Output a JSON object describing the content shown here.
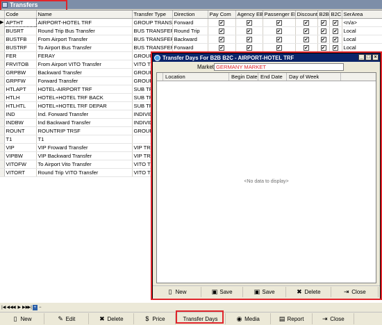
{
  "window": {
    "title": "Transfers"
  },
  "grid": {
    "headers": [
      "Code",
      "Name",
      "Transfer Type",
      "Direction",
      "Pay Com",
      "Agency EB",
      "Passenger EB",
      "Discount",
      "B2B",
      "B2C",
      "SerArea"
    ],
    "rows": [
      {
        "code": "APTHT",
        "name": "AIRPORT-HOTEL TRF",
        "type": "GROUP TRANSF",
        "direction": "Forward",
        "checks": [
          true,
          true,
          true,
          true,
          true,
          true
        ],
        "area": "<n/a>"
      },
      {
        "code": "BUSRT",
        "name": "Round Trip Bus Transfer",
        "type": "BUS TRANSFER",
        "direction": "Round Trip",
        "checks": [
          true,
          true,
          true,
          true,
          true,
          true
        ],
        "area": "Local"
      },
      {
        "code": "BUSTFB",
        "name": "From Airport Transfer",
        "type": "BUS TRANSFER",
        "direction": "Backward",
        "checks": [
          true,
          true,
          true,
          true,
          true,
          true
        ],
        "area": "Local"
      },
      {
        "code": "BUSTRF",
        "name": "To Airport Bus Transfer",
        "type": "BUS TRANSFER",
        "direction": "Forward",
        "checks": [
          true,
          true,
          true,
          true,
          true,
          true
        ],
        "area": "Local"
      },
      {
        "code": "FER",
        "name": "FERAY",
        "type": "GROUP",
        "direction": "",
        "checks": [],
        "area": ""
      },
      {
        "code": "FRVITOB",
        "name": "From Airport VITO Transfer",
        "type": "VITO TR",
        "direction": "",
        "checks": [],
        "area": ""
      },
      {
        "code": "GRPBW",
        "name": "Backward Transfer",
        "type": "GROUP",
        "direction": "",
        "checks": [],
        "area": ""
      },
      {
        "code": "GRPFW",
        "name": "Forward Transfer",
        "type": "GROUP",
        "direction": "",
        "checks": [],
        "area": ""
      },
      {
        "code": "HTLAPT",
        "name": "HOTEL-AIRPORT TRF",
        "type": "SUB TR",
        "direction": "",
        "checks": [],
        "area": ""
      },
      {
        "code": "HTLH",
        "name": "HOTEL+HOTEL TRF BACK",
        "type": "SUB TR",
        "direction": "",
        "checks": [],
        "area": ""
      },
      {
        "code": "HTLHTL",
        "name": "HOTEL+HOTEL TRF DEPAR",
        "type": "SUB TR",
        "direction": "",
        "checks": [],
        "area": ""
      },
      {
        "code": "IND",
        "name": "Ind. Forward Transfer",
        "type": "INDIVID",
        "direction": "",
        "checks": [],
        "area": ""
      },
      {
        "code": "INDBW",
        "name": "Ind Backward Transfer",
        "type": "INDIVID",
        "direction": "",
        "checks": [],
        "area": ""
      },
      {
        "code": "ROUNT",
        "name": "ROUNTRIP TRSF",
        "type": "GROUP",
        "direction": "",
        "checks": [],
        "area": ""
      },
      {
        "code": "T1",
        "name": "T1",
        "type": "",
        "direction": "",
        "checks": [],
        "area": ""
      },
      {
        "code": "VIP",
        "name": "VIP Froward Transfer",
        "type": "VIP TRA",
        "direction": "",
        "checks": [],
        "area": ""
      },
      {
        "code": "VIPBW",
        "name": "VIP Backward Transfer",
        "type": "VIP TRA",
        "direction": "",
        "checks": [],
        "area": ""
      },
      {
        "code": "VITOFW",
        "name": "To Airport Vito Transfer",
        "type": "VITO TR",
        "direction": "",
        "checks": [],
        "area": ""
      },
      {
        "code": "VITORT",
        "name": "Round Trip VITO Transfer",
        "type": "VITO TR",
        "direction": "",
        "checks": [],
        "area": ""
      }
    ]
  },
  "toolbar": [
    {
      "name": "new-button",
      "icon": "new-doc-icon",
      "glyph": "▯",
      "label": "New"
    },
    {
      "name": "edit-button",
      "icon": "edit-icon",
      "glyph": "✎",
      "label": "Edit"
    },
    {
      "name": "delete-button",
      "icon": "delete-icon",
      "glyph": "✖",
      "label": "Delete"
    },
    {
      "name": "price-button",
      "icon": "price-icon",
      "glyph": "$",
      "label": "Price"
    },
    {
      "name": "transfer-days-button",
      "icon": "",
      "glyph": "",
      "label": "Transfer Days"
    },
    {
      "name": "media-button",
      "icon": "media-icon",
      "glyph": "◉",
      "label": "Media"
    },
    {
      "name": "report-button",
      "icon": "printer-icon",
      "glyph": "▤",
      "label": "Report"
    },
    {
      "name": "close-button",
      "icon": "close-icon",
      "glyph": "⇥",
      "label": "Close"
    }
  ],
  "dialog": {
    "title": "Transfer Days For B2B B2C - AIRPORT-HOTEL TRF",
    "market_label": "Market",
    "market_value": "GERMANY MARKET",
    "headers": [
      "Location",
      "Begin Date",
      "End Date",
      "Day of Week"
    ],
    "empty_text": "<No data to display>",
    "toolbar": [
      {
        "name": "dialog-new-button",
        "icon": "new-doc-icon",
        "glyph": "▯",
        "label": "New"
      },
      {
        "name": "dialog-save-button",
        "icon": "save-icon",
        "glyph": "▣",
        "label": "Save"
      },
      {
        "name": "dialog-save-close-button",
        "icon": "save-icon",
        "glyph": "▣",
        "label": "Save"
      },
      {
        "name": "dialog-delete-button",
        "icon": "delete-icon",
        "glyph": "✖",
        "label": "Delete"
      },
      {
        "name": "dialog-close-button",
        "icon": "close-icon",
        "glyph": "⇥",
        "label": "Close"
      }
    ]
  },
  "colors": {
    "highlight": "#e0242a",
    "dialog_title": "#0a246a",
    "main_title": "#7d8ea8"
  }
}
